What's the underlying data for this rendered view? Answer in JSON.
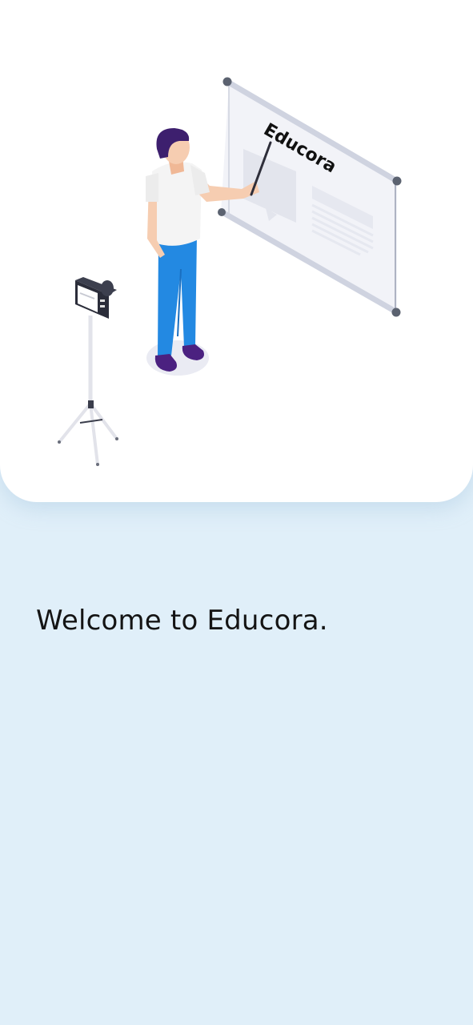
{
  "hero": {
    "board_text": "Educora"
  },
  "welcome": {
    "title": "Welcome to Educora."
  },
  "colors": {
    "background": "#e0eff9",
    "card": "#ffffff",
    "shirt": "#f4f4f4",
    "pants": "#2389e2",
    "hair": "#3d1f6e",
    "shoes": "#4b2180"
  },
  "icons": [
    "presentation-board",
    "presenter-person",
    "pointer-stick",
    "camera-on-tripod"
  ]
}
